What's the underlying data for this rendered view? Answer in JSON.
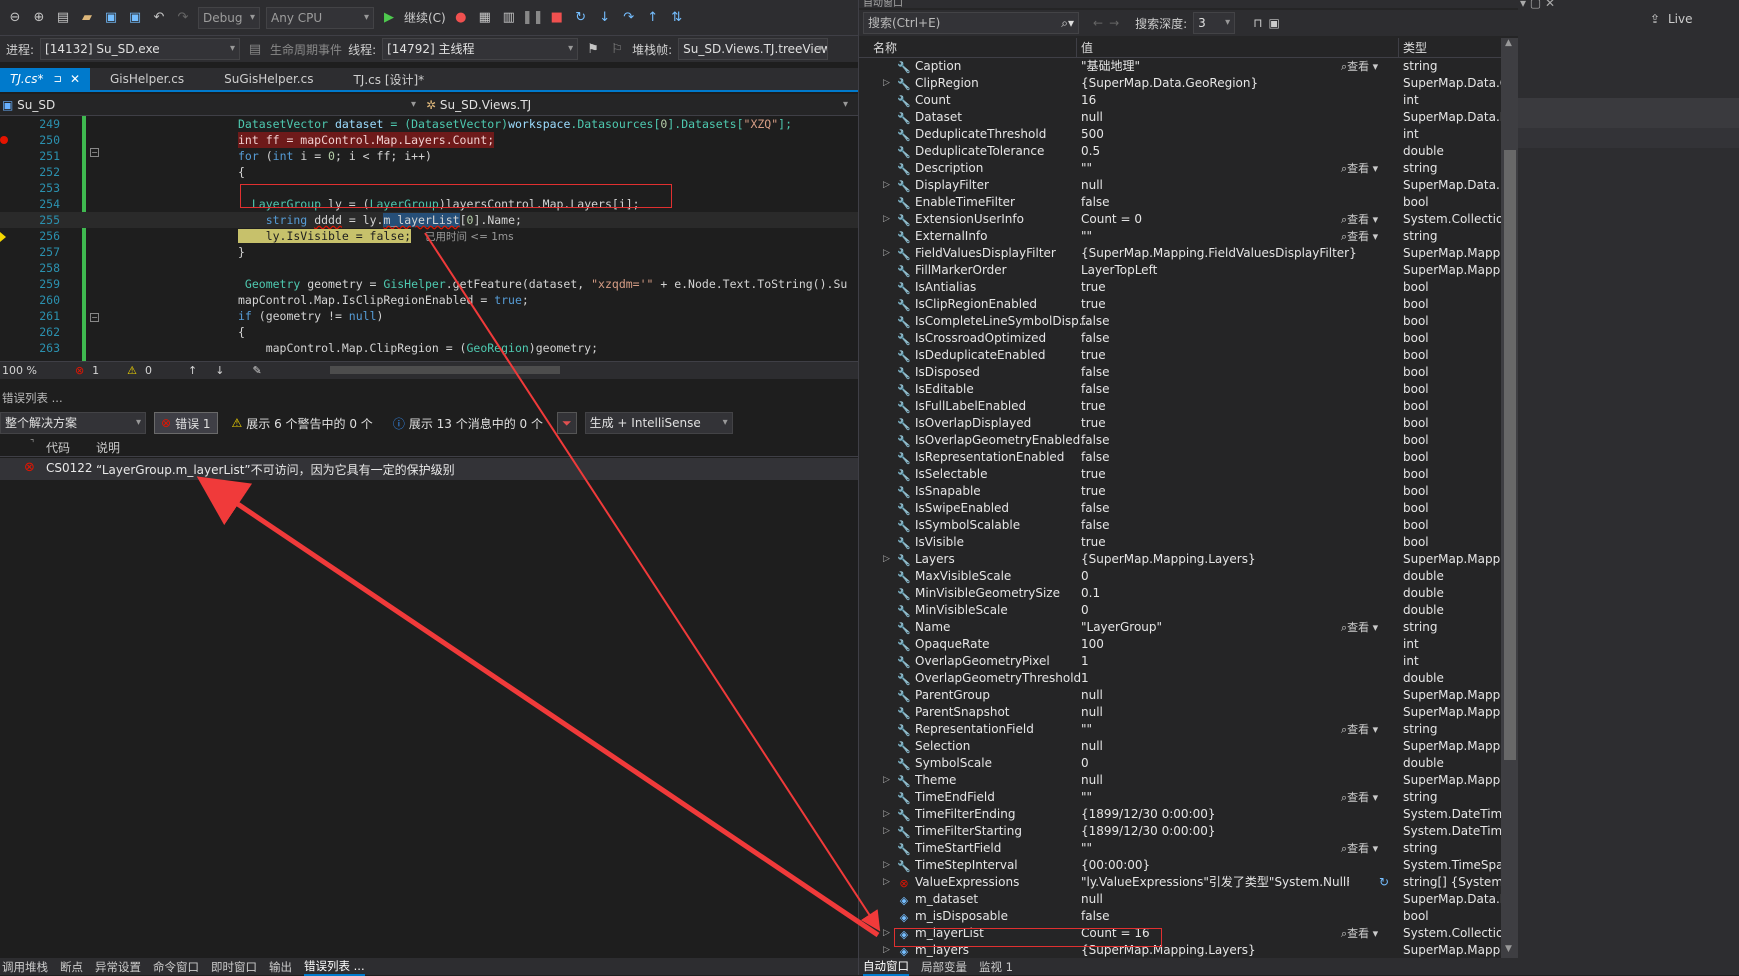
{
  "toolbar": {
    "config": "Debug",
    "platform": "Any CPU",
    "continue_label": "继续(C)",
    "process_label": "进程:",
    "process_value": "[14132] Su_SD.exe",
    "lifecycle_label": "生命周期事件",
    "thread_label": "线程:",
    "thread_value": "[14792] 主线程",
    "stack_label": "堆栈帧:",
    "stack_value": "Su_SD.Views.TJ.treeView_"
  },
  "tabs": [
    {
      "label": "TJ.cs*",
      "active": true
    },
    {
      "label": "GisHelper.cs",
      "active": false
    },
    {
      "label": "SuGisHelper.cs",
      "active": false
    },
    {
      "label": "TJ.cs [设计]*",
      "active": false
    }
  ],
  "navbar": {
    "left": "Su_SD",
    "right": "Su_SD.Views.TJ"
  },
  "code": {
    "lines": [
      {
        "n": "249",
        "t": "DatasetVector dataset = (DatasetVector)workspace.Datasources[0].Datasets[\"XZQ\"];",
        "indent": 0
      },
      {
        "n": "250",
        "t": "int ff = mapControl.Map.Layers.Count;",
        "indent": 0
      },
      {
        "n": "251",
        "t": "for (int i = 0; i < ff; i++)",
        "indent": 0
      },
      {
        "n": "252",
        "t": "{",
        "indent": 0
      },
      {
        "n": "253",
        "t": "",
        "indent": 0
      },
      {
        "n": "254",
        "t": "  LayerGroup ly = (LayerGroup)layersControl.Map.Layers[i];",
        "indent": 0
      },
      {
        "n": "255",
        "t": "    string dddd = ly.m_layerList[0].Name;",
        "indent": 0
      },
      {
        "n": "256",
        "t": "    ly.IsVisible = false;",
        "indent": 0
      },
      {
        "n": "257",
        "t": "}",
        "indent": 0
      },
      {
        "n": "258",
        "t": "",
        "indent": 0
      },
      {
        "n": "259",
        "t": " Geometry geometry = GisHelper.getFeature(dataset, \"xzqdm='\" + e.Node.Text.ToString().Su",
        "indent": 0
      },
      {
        "n": "260",
        "t": "mapControl.Map.IsClipRegionEnabled = true;",
        "indent": 0
      },
      {
        "n": "261",
        "t": "if (geometry != null)",
        "indent": 0
      },
      {
        "n": "262",
        "t": "{",
        "indent": 0
      },
      {
        "n": "263",
        "t": "    mapControl.Map.ClipRegion = (GeoRegion)geometry;",
        "indent": 0
      }
    ],
    "elapsed": "已用时间 <= 1ms"
  },
  "code_status": {
    "zoom": "100 %",
    "errors": "1",
    "warnings": "0"
  },
  "error_list": {
    "title": "错误列表 ...",
    "scope": "整个解决方案",
    "errors_btn": "错误 1",
    "warnings_btn": "展示 6 个警告中的 0 个",
    "messages_btn": "展示 13 个消息中的 0 个",
    "build_combo": "生成 + IntelliSense",
    "col_code": "代码",
    "col_desc": "说明",
    "row_code": "CS0122",
    "row_desc": "“LayerGroup.m_layerList”不可访问，因为它具有一定的保护级别"
  },
  "bottom_tabs": [
    "调用堆栈",
    "断点",
    "异常设置",
    "命令窗口",
    "即时窗口",
    "输出",
    "错误列表 ..."
  ],
  "autos": {
    "title": "自动窗口",
    "search_placeholder": "搜索(Ctrl+E)",
    "depth_label": "搜索深度:",
    "depth_value": "3",
    "col_name": "名称",
    "col_value": "值",
    "col_type": "类型",
    "view_label": "查看",
    "rows": [
      {
        "name": "Caption",
        "value": "\"基础地理\"",
        "type": "string",
        "exp": false,
        "view": true,
        "icon": "wrench"
      },
      {
        "name": "ClipRegion",
        "value": "{SuperMap.Data.GeoRegion}",
        "type": "SuperMap.Data.G...",
        "exp": true,
        "view": false,
        "icon": "wrench"
      },
      {
        "name": "Count",
        "value": "16",
        "type": "int",
        "exp": false,
        "view": false,
        "icon": "wrench"
      },
      {
        "name": "Dataset",
        "value": "null",
        "type": "SuperMap.Data.D...",
        "exp": false,
        "view": false,
        "icon": "wrench"
      },
      {
        "name": "DeduplicateThreshold",
        "value": "500",
        "type": "int",
        "exp": false,
        "view": false,
        "icon": "wrench"
      },
      {
        "name": "DeduplicateTolerance",
        "value": "0.5",
        "type": "double",
        "exp": false,
        "view": false,
        "icon": "wrench"
      },
      {
        "name": "Description",
        "value": "\"\"",
        "type": "string",
        "exp": false,
        "view": true,
        "icon": "wrench"
      },
      {
        "name": "DisplayFilter",
        "value": "null",
        "type": "SuperMap.Data....",
        "exp": true,
        "view": false,
        "icon": "wrench"
      },
      {
        "name": "EnableTimeFilter",
        "value": "false",
        "type": "bool",
        "exp": false,
        "view": false,
        "icon": "wrench"
      },
      {
        "name": "ExtensionUserInfo",
        "value": "Count = 0",
        "type": "System.Collectio...",
        "exp": true,
        "view": true,
        "icon": "wrench"
      },
      {
        "name": "ExternalInfo",
        "value": "\"\"",
        "type": "string",
        "exp": false,
        "view": true,
        "icon": "wrench"
      },
      {
        "name": "FieldValuesDisplayFilter",
        "value": "{SuperMap.Mapping.FieldValuesDisplayFilter}",
        "type": "SuperMap.Mappi...",
        "exp": true,
        "view": false,
        "icon": "wrench"
      },
      {
        "name": "FillMarkerOrder",
        "value": "LayerTopLeft",
        "type": "SuperMap.Mappi...",
        "exp": false,
        "view": false,
        "icon": "wrench"
      },
      {
        "name": "IsAntialias",
        "value": "true",
        "type": "bool",
        "exp": false,
        "view": false,
        "icon": "wrench"
      },
      {
        "name": "IsClipRegionEnabled",
        "value": "true",
        "type": "bool",
        "exp": false,
        "view": false,
        "icon": "wrench"
      },
      {
        "name": "IsCompleteLineSymbolDisp...",
        "value": "false",
        "type": "bool",
        "exp": false,
        "view": false,
        "icon": "wrench"
      },
      {
        "name": "IsCrossroadOptimized",
        "value": "false",
        "type": "bool",
        "exp": false,
        "view": false,
        "icon": "wrench"
      },
      {
        "name": "IsDeduplicateEnabled",
        "value": "true",
        "type": "bool",
        "exp": false,
        "view": false,
        "icon": "wrench"
      },
      {
        "name": "IsDisposed",
        "value": "false",
        "type": "bool",
        "exp": false,
        "view": false,
        "icon": "wrench"
      },
      {
        "name": "IsEditable",
        "value": "false",
        "type": "bool",
        "exp": false,
        "view": false,
        "icon": "wrench"
      },
      {
        "name": "IsFullLabelEnabled",
        "value": "true",
        "type": "bool",
        "exp": false,
        "view": false,
        "icon": "wrench"
      },
      {
        "name": "IsOverlapDisplayed",
        "value": "true",
        "type": "bool",
        "exp": false,
        "view": false,
        "icon": "wrench"
      },
      {
        "name": "IsOverlapGeometryEnabled",
        "value": "false",
        "type": "bool",
        "exp": false,
        "view": false,
        "icon": "wrench"
      },
      {
        "name": "IsRepresentationEnabled",
        "value": "false",
        "type": "bool",
        "exp": false,
        "view": false,
        "icon": "wrench"
      },
      {
        "name": "IsSelectable",
        "value": "true",
        "type": "bool",
        "exp": false,
        "view": false,
        "icon": "wrench"
      },
      {
        "name": "IsSnapable",
        "value": "true",
        "type": "bool",
        "exp": false,
        "view": false,
        "icon": "wrench"
      },
      {
        "name": "IsSwipeEnabled",
        "value": "false",
        "type": "bool",
        "exp": false,
        "view": false,
        "icon": "wrench"
      },
      {
        "name": "IsSymbolScalable",
        "value": "false",
        "type": "bool",
        "exp": false,
        "view": false,
        "icon": "wrench"
      },
      {
        "name": "IsVisible",
        "value": "true",
        "type": "bool",
        "exp": false,
        "view": false,
        "icon": "wrench"
      },
      {
        "name": "Layers",
        "value": "{SuperMap.Mapping.Layers}",
        "type": "SuperMap.Mappi...",
        "exp": true,
        "view": false,
        "icon": "wrench"
      },
      {
        "name": "MaxVisibleScale",
        "value": "0",
        "type": "double",
        "exp": false,
        "view": false,
        "icon": "wrench"
      },
      {
        "name": "MinVisibleGeometrySize",
        "value": "0.1",
        "type": "double",
        "exp": false,
        "view": false,
        "icon": "wrench"
      },
      {
        "name": "MinVisibleScale",
        "value": "0",
        "type": "double",
        "exp": false,
        "view": false,
        "icon": "wrench"
      },
      {
        "name": "Name",
        "value": "\"LayerGroup\"",
        "type": "string",
        "exp": false,
        "view": true,
        "icon": "wrench"
      },
      {
        "name": "OpaqueRate",
        "value": "100",
        "type": "int",
        "exp": false,
        "view": false,
        "icon": "wrench"
      },
      {
        "name": "OverlapGeometryPixel",
        "value": "1",
        "type": "int",
        "exp": false,
        "view": false,
        "icon": "wrench"
      },
      {
        "name": "OverlapGeometryThreshold",
        "value": "1",
        "type": "double",
        "exp": false,
        "view": false,
        "icon": "wrench"
      },
      {
        "name": "ParentGroup",
        "value": "null",
        "type": "SuperMap.Mappi...",
        "exp": false,
        "view": false,
        "icon": "wrench"
      },
      {
        "name": "ParentSnapshot",
        "value": "null",
        "type": "SuperMap.Mappi...",
        "exp": false,
        "view": false,
        "icon": "wrench"
      },
      {
        "name": "RepresentationField",
        "value": "\"\"",
        "type": "string",
        "exp": false,
        "view": true,
        "icon": "wrench"
      },
      {
        "name": "Selection",
        "value": "null",
        "type": "SuperMap.Mappi...",
        "exp": false,
        "view": false,
        "icon": "wrench"
      },
      {
        "name": "SymbolScale",
        "value": "0",
        "type": "double",
        "exp": false,
        "view": false,
        "icon": "wrench"
      },
      {
        "name": "Theme",
        "value": "null",
        "type": "SuperMap.Mappi...",
        "exp": true,
        "view": false,
        "icon": "wrench"
      },
      {
        "name": "TimeEndField",
        "value": "\"\"",
        "type": "string",
        "exp": false,
        "view": true,
        "icon": "wrench"
      },
      {
        "name": "TimeFilterEnding",
        "value": "{1899/12/30 0:00:00}",
        "type": "System.DateTime",
        "exp": true,
        "view": false,
        "icon": "wrench"
      },
      {
        "name": "TimeFilterStarting",
        "value": "{1899/12/30 0:00:00}",
        "type": "System.DateTime",
        "exp": true,
        "view": false,
        "icon": "wrench"
      },
      {
        "name": "TimeStartField",
        "value": "\"\"",
        "type": "string",
        "exp": false,
        "view": true,
        "icon": "wrench"
      },
      {
        "name": "TimeStepInterval",
        "value": "{00:00:00}",
        "type": "System.TimeSpan",
        "exp": true,
        "view": false,
        "icon": "wrench"
      },
      {
        "name": "ValueExpressions",
        "value": "\"ly.ValueExpressions\"引发了类型\"System.NullReferen...",
        "type": "string[] {System....",
        "exp": true,
        "view": false,
        "icon": "error"
      },
      {
        "name": "m_dataset",
        "value": "null",
        "type": "SuperMap.Data.D...",
        "exp": false,
        "view": false,
        "icon": "field"
      },
      {
        "name": "m_isDisposable",
        "value": "false",
        "type": "bool",
        "exp": false,
        "view": false,
        "icon": "field"
      },
      {
        "name": "m_layerList",
        "value": "Count = 16",
        "type": "System.Collectio...",
        "exp": true,
        "view": true,
        "icon": "field"
      },
      {
        "name": "m_layers",
        "value": "{SuperMap.Mapping.Layers}",
        "type": "SuperMap.Mappi...",
        "exp": true,
        "view": false,
        "icon": "field"
      }
    ],
    "bottom_tabs": [
      "自动窗口",
      "局部变量",
      "监视 1"
    ]
  },
  "right_strip": {
    "live_label": "Live"
  },
  "colors": {
    "accent": "#007acc",
    "error": "#e51400",
    "arrow": "#f03a3a",
    "debug_green": "#4ec94e"
  }
}
